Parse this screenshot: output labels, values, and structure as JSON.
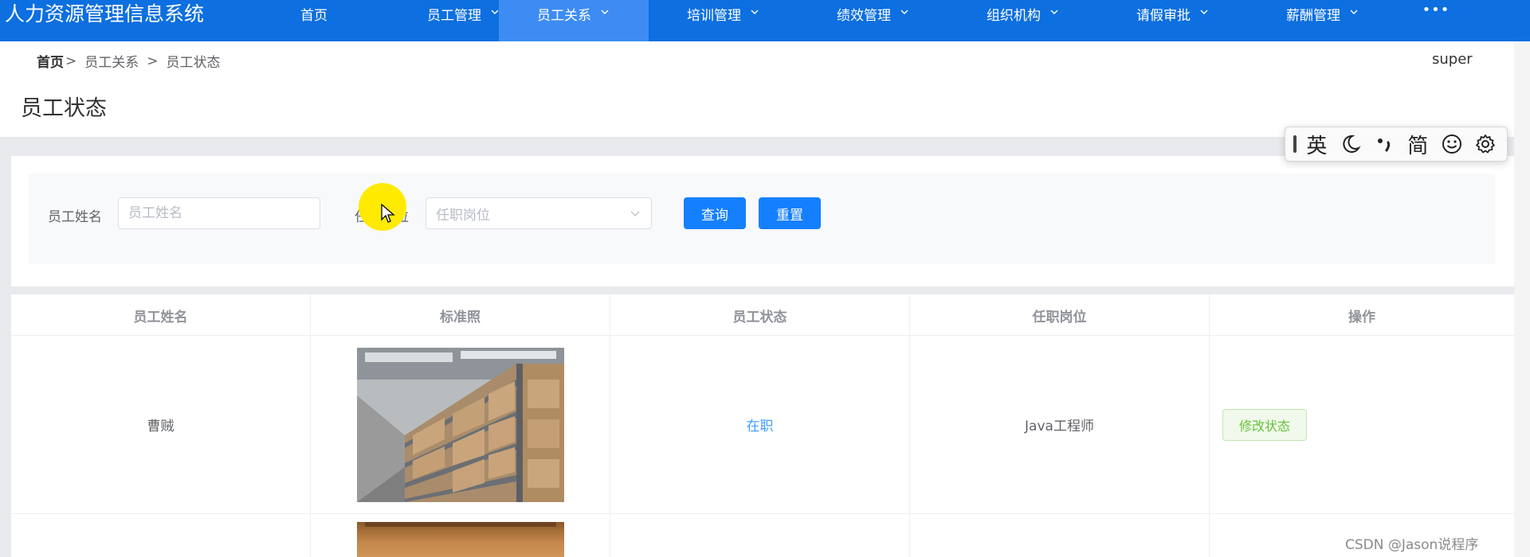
{
  "app": {
    "title": "人力资源管理信息系统"
  },
  "nav": {
    "items": [
      {
        "label": "首页",
        "dropdown": false,
        "active": false
      },
      {
        "label": "员工管理",
        "dropdown": true,
        "active": false
      },
      {
        "label": "员工关系",
        "dropdown": true,
        "active": true
      },
      {
        "label": "培训管理",
        "dropdown": true,
        "active": false
      },
      {
        "label": "绩效管理",
        "dropdown": true,
        "active": false
      },
      {
        "label": "组织机构",
        "dropdown": true,
        "active": false
      },
      {
        "label": "请假审批",
        "dropdown": true,
        "active": false
      },
      {
        "label": "薪酬管理",
        "dropdown": true,
        "active": false
      }
    ],
    "more": "•••"
  },
  "breadcrumb": {
    "home": "首页",
    "sep": ">",
    "level1": "员工关系",
    "level2": "员工状态"
  },
  "user": {
    "name": "super"
  },
  "page": {
    "title": "员工状态"
  },
  "ime": {
    "lang": "英",
    "script": "简"
  },
  "search": {
    "name_label": "员工姓名",
    "name_placeholder": "员工姓名",
    "name_value": "",
    "post_label": "任职岗位",
    "post_placeholder": "任职岗位",
    "query_label": "查询",
    "reset_label": "重置"
  },
  "table": {
    "headers": [
      "员工姓名",
      "标准照",
      "员工状态",
      "任职岗位",
      "操作"
    ],
    "rows": [
      {
        "name": "曹贼",
        "photo": "warehouse-shelves-photo",
        "status": "在职",
        "post": "Java工程师",
        "action": "修改状态"
      },
      {
        "name": "",
        "photo": "warm-room-photo",
        "status": "",
        "post": "",
        "action": ""
      }
    ]
  },
  "watermark": "CSDN @Jason说程序",
  "colors": {
    "nav_bg": "#0d6fe0",
    "nav_active": "#3d8cf3",
    "primary": "#1580ff",
    "status_link": "#409eff",
    "success_tag": "#67c23a"
  }
}
